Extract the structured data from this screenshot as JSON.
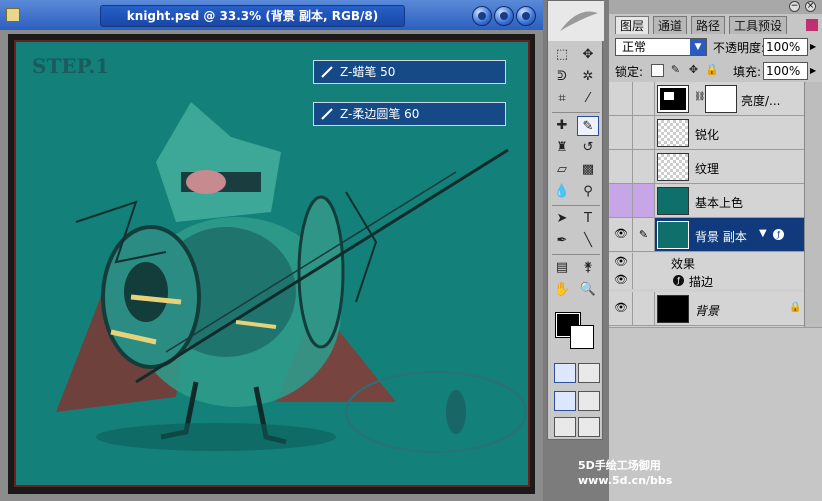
{
  "document": {
    "title": "knight.psd @ 33.3% (背景 副本, RGB/8)",
    "step_label": "STEP.1",
    "brush_tags": [
      "Z-蜡笔 50",
      "Z-柔边圆笔 60"
    ]
  },
  "watermark": {
    "line1": "5D手绘工场御用",
    "line2": "www.5d.cn/bbs"
  },
  "layers_panel": {
    "tabs": [
      "图层",
      "通道",
      "路径",
      "工具预设"
    ],
    "active_tab": "图层",
    "blend_mode": "正常",
    "opacity_label": "不透明度:",
    "opacity_value": "100%",
    "lock_label": "锁定:",
    "fill_label": "填充:",
    "fill_value": "100%",
    "layers": [
      {
        "name": "亮度/...",
        "thumb": "adjustment",
        "visible": false,
        "selected": false
      },
      {
        "name": "锐化",
        "thumb": "checker",
        "visible": false,
        "selected": false
      },
      {
        "name": "纹理",
        "thumb": "checker",
        "visible": false,
        "selected": false
      },
      {
        "name": "基本上色",
        "thumb": "art",
        "visible": false,
        "selected": false,
        "highlight": "purple"
      },
      {
        "name": "背景 副本",
        "thumb": "art",
        "visible": true,
        "selected": true
      },
      {
        "name": "背景",
        "thumb": "black",
        "visible": true,
        "selected": false,
        "locked": true
      }
    ],
    "effects_label": "效果",
    "stroke_effect_label": "描边"
  },
  "colors": {
    "canvas": "#13807a",
    "titlebar": "#2c5fbf",
    "selected_layer": "#103a7c",
    "brush_tag": "#154a87"
  }
}
